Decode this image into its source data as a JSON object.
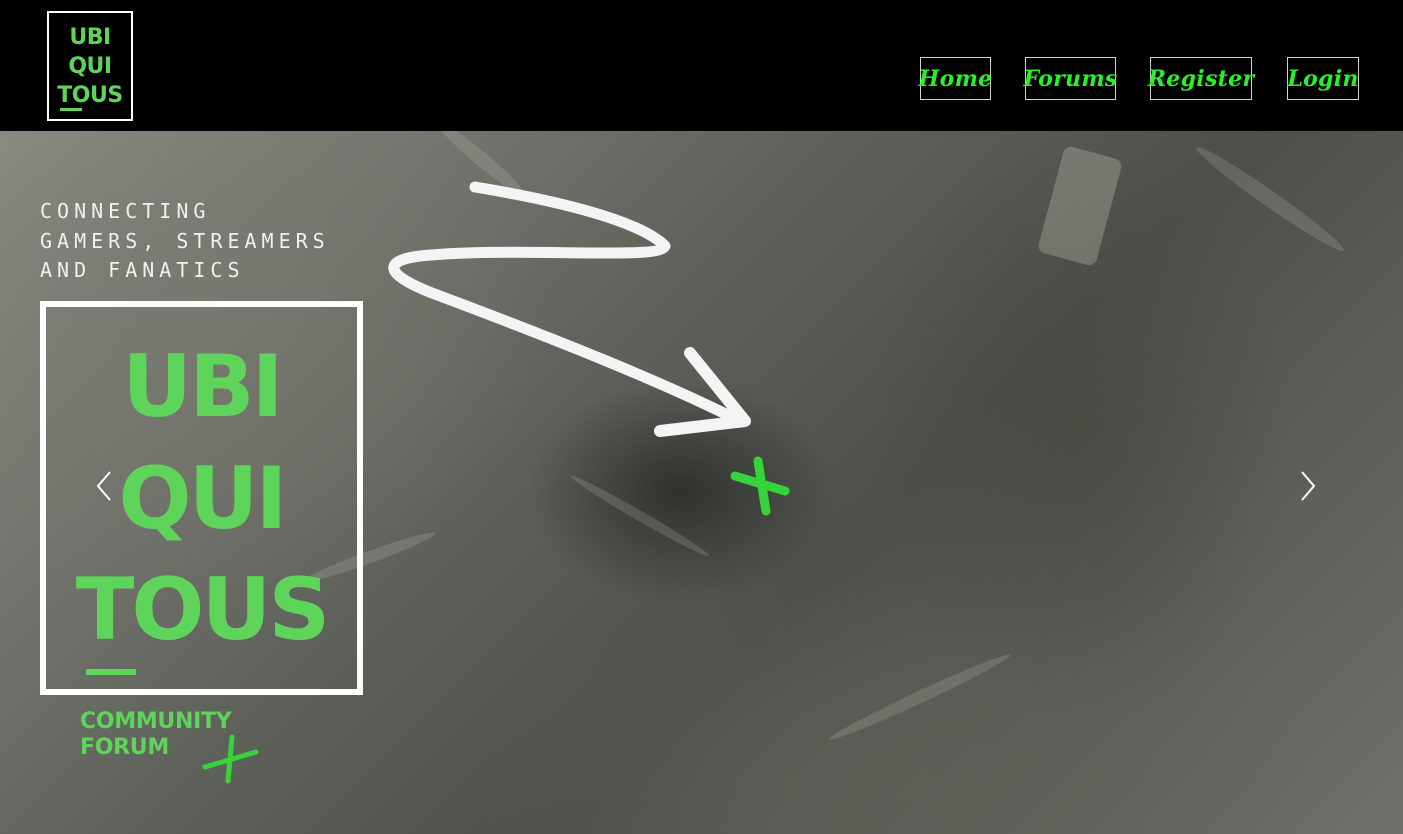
{
  "header": {
    "logo_lines": [
      "UBI",
      "QUI",
      "TOUS"
    ],
    "nav": [
      "Home",
      "Forums",
      "Register",
      "Login"
    ]
  },
  "hero": {
    "tagline": [
      "CONNECTING",
      "GAMERS, STREAMERS",
      "AND FANATICS"
    ],
    "big_logo_lines": [
      "UBI",
      "QUI",
      "TOUS"
    ],
    "community": [
      "COMMUNITY",
      "FORUM"
    ],
    "icons": [
      "arrow-icon",
      "plus-icon",
      "chevron-left-icon",
      "chevron-right-icon"
    ]
  },
  "colors": {
    "accent": "#5fd45a",
    "nav_text": "#27f227",
    "background": "#000000"
  }
}
